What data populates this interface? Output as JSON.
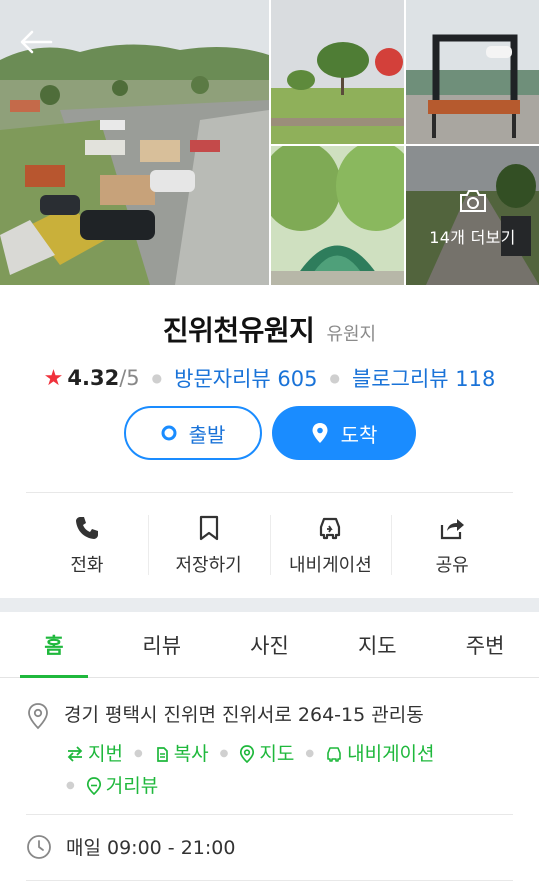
{
  "gallery": {
    "more_label": "14개 더보기",
    "icons": {
      "back": "arrow-left-icon",
      "camera": "camera-icon"
    }
  },
  "place": {
    "name": "진위천유원지",
    "category": "유원지",
    "rating": "4.32",
    "rating_max": "/5",
    "visitor_reviews": "방문자리뷰 605",
    "blog_reviews": "블로그리뷰 118"
  },
  "route": {
    "start_label": "출발",
    "arrive_label": "도착"
  },
  "actions": [
    {
      "label": "전화",
      "icon": "phone-icon"
    },
    {
      "label": "저장하기",
      "icon": "bookmark-icon"
    },
    {
      "label": "내비게이션",
      "icon": "car-icon"
    },
    {
      "label": "공유",
      "icon": "share-icon"
    }
  ],
  "tabs": [
    "홈",
    "리뷰",
    "사진",
    "지도",
    "주변"
  ],
  "active_tab": "홈",
  "info": {
    "address": "경기 평택시 진위면 진위서로 264-15 관리동",
    "address_actions": [
      {
        "label": "지번",
        "icon": "swap-icon"
      },
      {
        "label": "복사",
        "icon": "copy-icon"
      },
      {
        "label": "지도",
        "icon": "map-pin-icon"
      },
      {
        "label": "내비게이션",
        "icon": "car-icon"
      },
      {
        "label": "거리뷰",
        "icon": "street-view-icon"
      }
    ],
    "hours": "매일 09:00 - 21:00"
  },
  "colors": {
    "primary_blue": "#1a8cff",
    "link_blue": "#1a73d8",
    "green": "#1fb83c",
    "star_red": "#f0323c"
  }
}
